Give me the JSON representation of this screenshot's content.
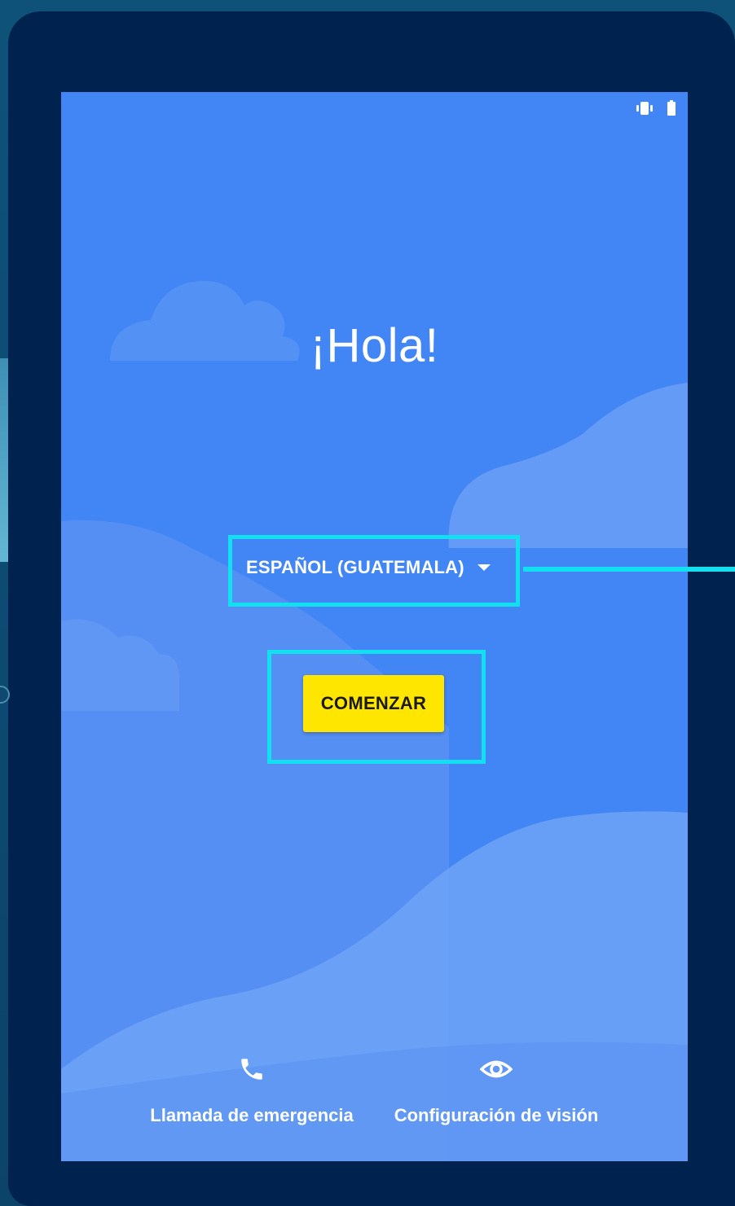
{
  "status_bar": {
    "icons": [
      "vibrate-icon",
      "battery-icon"
    ]
  },
  "welcome": {
    "title": "¡Hola!"
  },
  "language_selector": {
    "label": "ESPAÑOL (GUATEMALA)",
    "icon": "dropdown-caret-icon"
  },
  "start_button": {
    "label": "COMENZAR"
  },
  "bottom_actions": {
    "emergency": {
      "label": "Llamada de emergencia",
      "icon": "phone-icon"
    },
    "vision": {
      "label": "Configuración de visión",
      "icon": "eye-icon"
    }
  },
  "colors": {
    "screen_background": "#4285f4",
    "start_button": "#ffe600",
    "device_bezel": "#00224e",
    "highlight": "#12e0f0"
  }
}
